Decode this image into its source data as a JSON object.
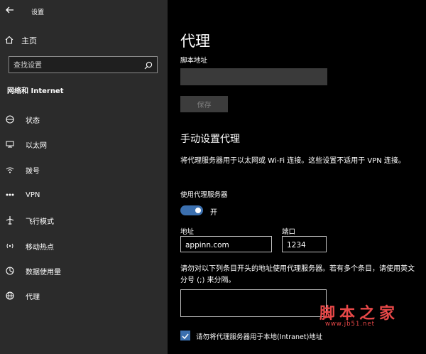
{
  "window": {
    "title": "设置"
  },
  "sidebar": {
    "home_label": "主页",
    "search_placeholder": "查找设置",
    "section_title": "网络和 Internet",
    "items": [
      {
        "label": "状态",
        "icon": "status-icon"
      },
      {
        "label": "以太网",
        "icon": "ethernet-icon"
      },
      {
        "label": "拨号",
        "icon": "dialup-icon"
      },
      {
        "label": "VPN",
        "icon": "vpn-icon"
      },
      {
        "label": "飞行模式",
        "icon": "airplane-icon"
      },
      {
        "label": "移动热点",
        "icon": "hotspot-icon"
      },
      {
        "label": "数据使用量",
        "icon": "data-usage-icon"
      },
      {
        "label": "代理",
        "icon": "proxy-icon"
      }
    ]
  },
  "main": {
    "title": "代理",
    "script_address_label": "脚本地址",
    "save_label": "保存",
    "manual_title": "手动设置代理",
    "manual_desc": "将代理服务器用于以太网或 Wi-Fi 连接。这些设置不适用于 VPN 连接。",
    "use_proxy_label": "使用代理服务器",
    "toggle_state": "开",
    "toggle_on": true,
    "address_label": "地址",
    "address_value": "appinn.com",
    "port_label": "端口",
    "port_value": "1234",
    "exceptions_desc": "请勿对以下列条目开头的地址使用代理服务器。若有多个条目，请使用英文分号 (;) 来分隔。",
    "exceptions_value": "",
    "local_checkbox_label": "请勿将代理服务器用于本地(Intranet)地址",
    "local_checked": true
  },
  "watermark": {
    "text": "脚本之家",
    "url": "www.jb51.net"
  },
  "colors": {
    "sidebar_bg": "#2b2b2b",
    "main_bg": "#000000",
    "accent": "#3b6fae",
    "watermark": "#e84848"
  }
}
